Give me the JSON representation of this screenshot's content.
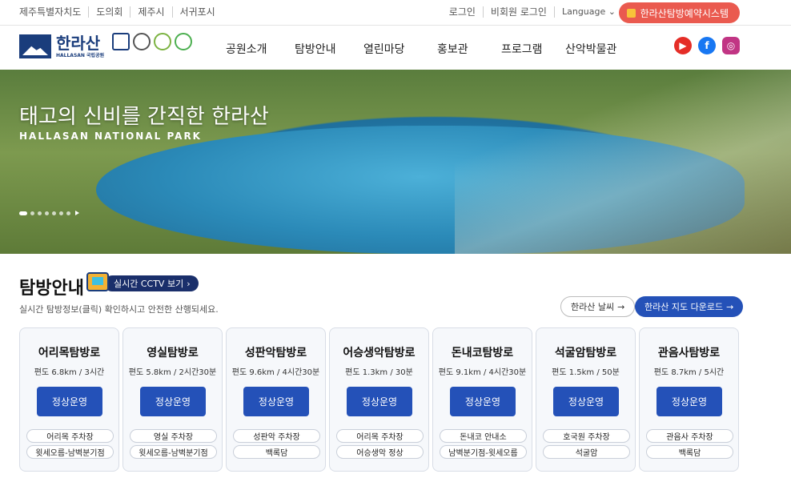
{
  "util_links": [
    "제주특별자치도",
    "도의회",
    "제주시",
    "서귀포시"
  ],
  "auth": {
    "login": "로그인",
    "guest_login": "비회원 로그인",
    "language": "Language"
  },
  "reserve_button": "한라산탐방예약시스템",
  "logo": {
    "kr": "한라산",
    "en": "HALLASAN 국립공원"
  },
  "nav": [
    "공원소개",
    "탐방안내",
    "열린마당",
    "홍보관",
    "프로그램",
    "산악박물관"
  ],
  "social_icons": [
    "youtube-icon",
    "facebook-icon",
    "instagram-icon"
  ],
  "hero": {
    "title": "태고의 신비를 간직한 한라산",
    "subtitle": "HALLASAN NATIONAL PARK",
    "slide_count": 8
  },
  "section": {
    "title": "탐방안내",
    "cctv_label": "실시간 CCTV 보기",
    "desc": "실시간 탐방정보(클릭) 확인하시고 안전한 산행되세요.",
    "weather_label": "한라산 날씨",
    "map_label": "한라산 지도 다운로드"
  },
  "trails": [
    {
      "name": "어리목탐방로",
      "info": "편도 6.8km / 3시간",
      "status": "정상운영",
      "stops": [
        "어리목 주차장",
        "윗세오름-남벽분기점"
      ]
    },
    {
      "name": "영실탐방로",
      "info": "편도 5.8km / 2시간30분",
      "status": "정상운영",
      "stops": [
        "영실 주차장",
        "윗세오름-남벽분기점"
      ]
    },
    {
      "name": "성판악탐방로",
      "info": "편도 9.6km / 4시간30분",
      "status": "정상운영",
      "stops": [
        "성판악 주차장",
        "백록담"
      ]
    },
    {
      "name": "어승생악탐방로",
      "info": "편도 1.3km / 30분",
      "status": "정상운영",
      "stops": [
        "어리목 주차장",
        "어승생악 정상"
      ]
    },
    {
      "name": "돈내코탐방로",
      "info": "편도 9.1km / 4시간30분",
      "status": "정상운영",
      "stops": [
        "돈내코 안내소",
        "남벽분기점-윗세오름"
      ]
    },
    {
      "name": "석굴암탐방로",
      "info": "편도 1.5km / 50분",
      "status": "정상운영",
      "stops": [
        "호국원 주차장",
        "석굴암"
      ]
    },
    {
      "name": "관음사탐방로",
      "info": "편도 8.7km / 5시간",
      "status": "정상운영",
      "stops": [
        "관음사 주차장",
        "백록담"
      ]
    }
  ]
}
